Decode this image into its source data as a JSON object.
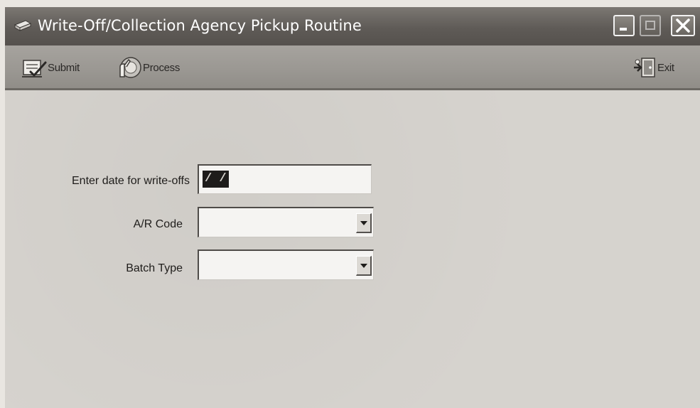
{
  "window": {
    "title": "Write-Off/Collection Agency Pickup Routine",
    "controls": {
      "minimize_icon": "minimize-icon",
      "maximize_icon": "maximize-icon",
      "close_icon": "close-icon"
    },
    "title_icon": "app-icon"
  },
  "toolbar": {
    "submit_label": "Submit",
    "submit_icon": "submit-form-icon",
    "process_label": "Process",
    "process_icon": "process-icon",
    "exit_label": "Exit",
    "exit_icon": "exit-door-icon"
  },
  "form": {
    "date_label": "Enter date for write-offs",
    "date_value": "/ /",
    "ar_code_label": "A/R Code",
    "ar_code_value": "",
    "batch_type_label": "Batch Type",
    "batch_type_value": ""
  },
  "colors": {
    "titlebar": "#5f5b57",
    "toolbar": "#9a9792",
    "content_background": "#d6d3ce",
    "field_background": "#f5f4f2"
  }
}
